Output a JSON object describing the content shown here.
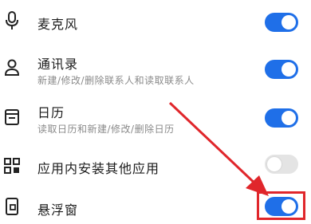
{
  "permissions": [
    {
      "icon": "microphone-icon",
      "title": "麦克风",
      "subtitle": "",
      "enabled": true
    },
    {
      "icon": "contacts-icon",
      "title": "通讯录",
      "subtitle": "新建/修改/删除联系人和读取联系人",
      "enabled": true
    },
    {
      "icon": "calendar-icon",
      "title": "日历",
      "subtitle": "读取日历和新建/修改/删除日历",
      "enabled": true
    },
    {
      "icon": "install-apps-icon",
      "title": "应用内安装其他应用",
      "subtitle": "",
      "enabled": false
    },
    {
      "icon": "floating-window-icon",
      "title": "悬浮窗",
      "subtitle": "",
      "enabled": true
    }
  ],
  "colors": {
    "toggle_on": "#1f6fe8",
    "toggle_off": "#e4e4e4",
    "annotation": "#e0262b"
  }
}
